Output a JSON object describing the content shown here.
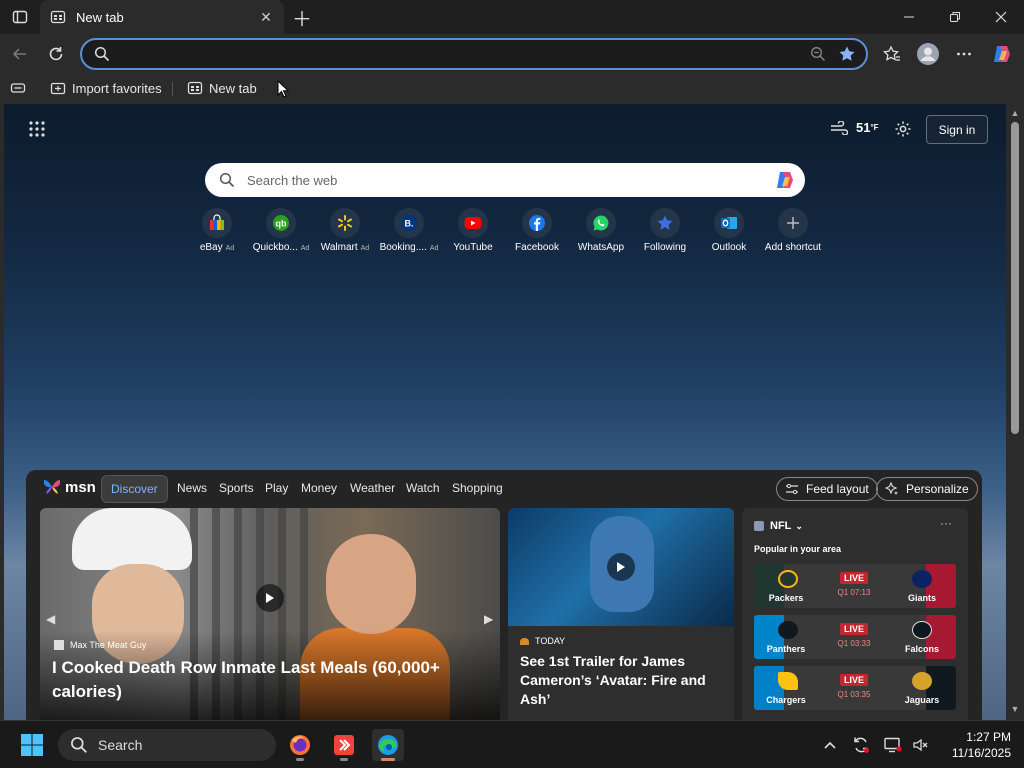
{
  "browser": {
    "tab": {
      "title": "New tab"
    },
    "omnibox": {
      "value": "",
      "placeholder": ""
    },
    "favorites": [
      {
        "label": "Import favorites"
      },
      {
        "label": "New tab"
      }
    ]
  },
  "newtab": {
    "weather": {
      "temp": "51",
      "unit": "°F"
    },
    "signin_label": "Sign in",
    "search_placeholder": "Search the web",
    "ad_label": "Ad",
    "shortcuts": [
      {
        "label": "eBay",
        "ad": true,
        "color": "#e53238"
      },
      {
        "label": "Quickbo...",
        "ad": true,
        "color": "#2ca01c"
      },
      {
        "label": "Walmart",
        "ad": true,
        "color": "#0071ce"
      },
      {
        "label": "Booking....",
        "ad": true,
        "color": "#003580"
      },
      {
        "label": "YouTube",
        "ad": false,
        "color": "#ff0000"
      },
      {
        "label": "Facebook",
        "ad": false,
        "color": "#1877f2"
      },
      {
        "label": "WhatsApp",
        "ad": false,
        "color": "#25d366"
      },
      {
        "label": "Following",
        "ad": false,
        "color": "#3b6fe0"
      },
      {
        "label": "Outlook",
        "ad": false,
        "color": "#0f6cbd"
      },
      {
        "label": "Add shortcut",
        "ad": false,
        "color": "#8a8a8a"
      }
    ]
  },
  "feed": {
    "brand": "msn",
    "nav": [
      "Discover",
      "News",
      "Sports",
      "Play",
      "Money",
      "Weather",
      "Watch",
      "Shopping"
    ],
    "active_nav": "Discover",
    "feed_layout_label": "Feed layout",
    "personalize_label": "Personalize",
    "hero": {
      "source": "Max The Meat Guy",
      "headline": "I Cooked Death Row Inmate Last Meals (60,000+ calories)"
    },
    "card": {
      "source": "TODAY",
      "headline": "See 1st Trailer for James Cameron’s ‘Avatar: Fire and Ash’"
    },
    "nfl": {
      "title": "NFL",
      "subtitle": "Popular in your area",
      "live_label": "LIVE",
      "games": [
        {
          "home": "Packers",
          "away": "Giants",
          "clock": "Q1 07:13",
          "home_color": "#203731",
          "away_color": "#a71930"
        },
        {
          "home": "Panthers",
          "away": "Falcons",
          "clock": "Q1 03:33",
          "home_color": "#0085ca",
          "away_color": "#a71930"
        },
        {
          "home": "Chargers",
          "away": "Jaguars",
          "clock": "Q1 03:35",
          "home_color": "#0080c6",
          "away_color": "#101820"
        }
      ]
    }
  },
  "taskbar": {
    "search_label": "Search",
    "time": "1:27 PM",
    "date": "11/16/2025"
  },
  "colors": {
    "accent": "#5b8fd8",
    "live_red": "#c4262e",
    "nav_active": "#7cb4ff"
  }
}
